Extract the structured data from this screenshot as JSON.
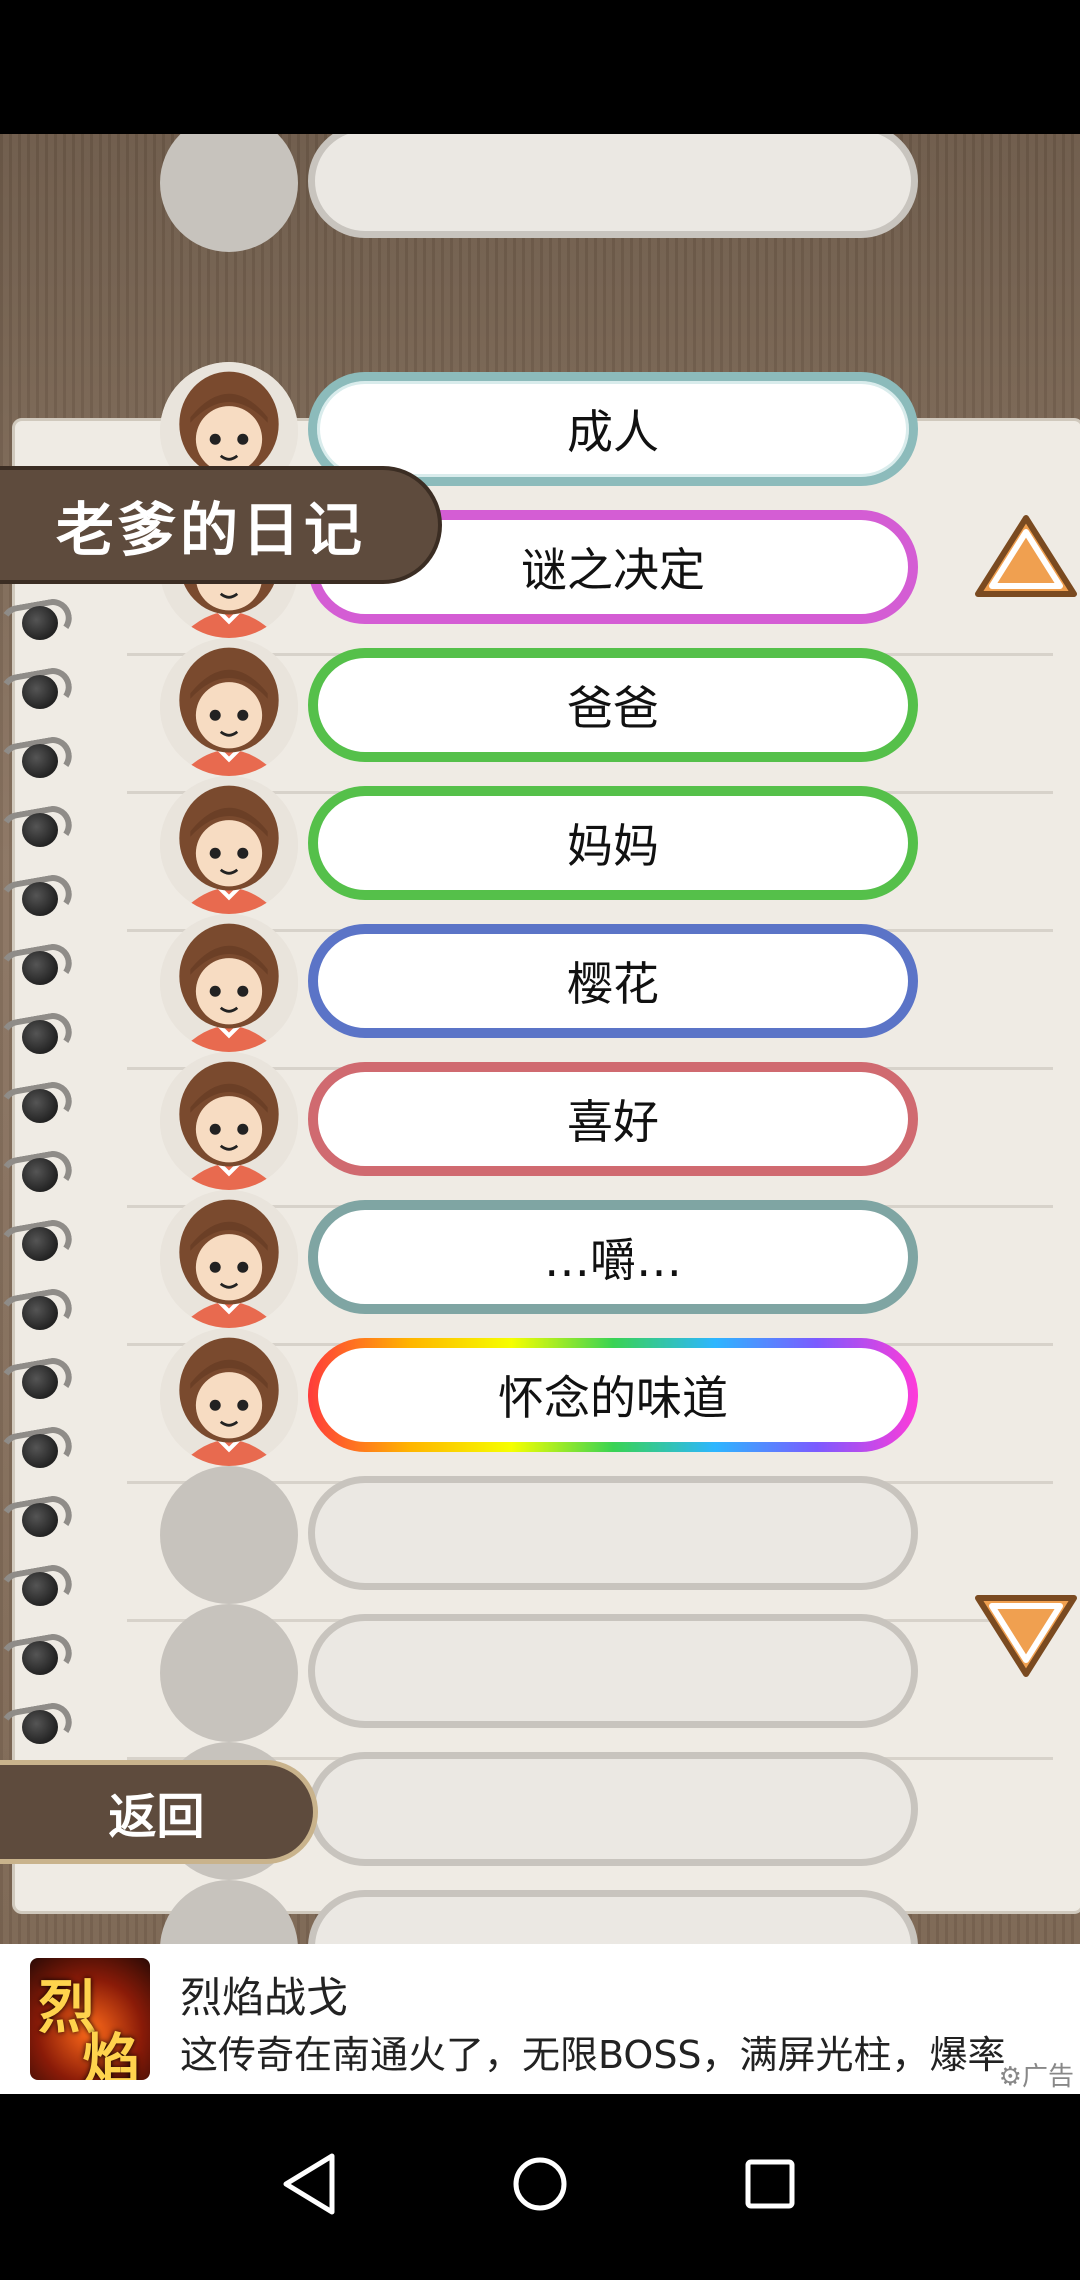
{
  "header": {
    "title": "老爹的日记"
  },
  "items": [
    {
      "label": "成人",
      "style": "teal",
      "unlocked": true
    },
    {
      "label": "谜之决定",
      "style": "magenta",
      "unlocked": true
    },
    {
      "label": "爸爸",
      "style": "green",
      "unlocked": true
    },
    {
      "label": "妈妈",
      "style": "green",
      "unlocked": true
    },
    {
      "label": "樱花",
      "style": "blue",
      "unlocked": true
    },
    {
      "label": "喜好",
      "style": "red",
      "unlocked": true
    },
    {
      "label": "…嚼…",
      "style": "teal",
      "unlocked": true
    },
    {
      "label": "怀念的味道",
      "style": "rainbow",
      "unlocked": true
    },
    {
      "label": "",
      "style": "empty",
      "unlocked": false
    },
    {
      "label": "",
      "style": "empty",
      "unlocked": false
    },
    {
      "label": "",
      "style": "empty",
      "unlocked": false
    },
    {
      "label": "",
      "style": "empty",
      "unlocked": false
    }
  ],
  "controls": {
    "back_label": "返回",
    "scroll_up_icon": "triangle-up-icon",
    "scroll_down_icon": "triangle-down-icon"
  },
  "ad": {
    "title": "烈焰战戈",
    "description": "这传奇在南通火了，无限BOSS，满屏光柱，爆率",
    "tag": "广告",
    "logo_text": "烈焰"
  },
  "colors": {
    "frame_brown": "#5e4b3d",
    "arrow_orange": "#f0a050",
    "paper": "#efebe4"
  }
}
